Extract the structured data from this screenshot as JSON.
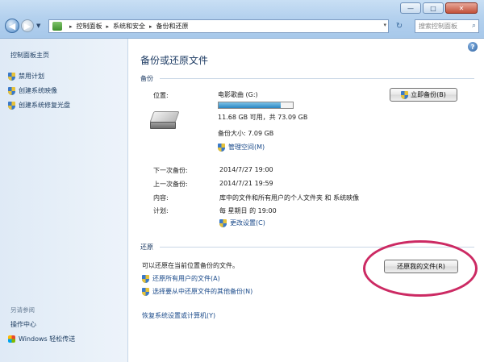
{
  "window": {
    "minimize_glyph": "—",
    "maximize_glyph": "□",
    "close_glyph": "✕"
  },
  "nav": {
    "back_glyph": "◀",
    "forward_glyph": "▶",
    "dropdown_glyph": "▼"
  },
  "address": {
    "crumbs": [
      "控制面板",
      "系统和安全",
      "备份和还原"
    ],
    "separator": "▸",
    "dropdown_glyph": "▾",
    "refresh_glyph": "↻"
  },
  "search": {
    "placeholder": "搜索控制面板",
    "icon_glyph": "⌕"
  },
  "sidebar": {
    "home": "控制面板主页",
    "items": [
      "禁用计划",
      "创建系统映像",
      "创建系统修复光盘"
    ],
    "see_also": "另请参阅",
    "links": [
      "操作中心",
      "Windows 轻松传送"
    ]
  },
  "help_glyph": "?",
  "main": {
    "title": "备份或还原文件",
    "backup": {
      "section": "备份",
      "location_label": "位置:",
      "drive_name": "电影歌曲 (G:)",
      "usage_fraction": 0.84,
      "space_text": "11.68 GB 可用，共 73.09 GB",
      "backup_size": "备份大小: 7.09 GB",
      "manage_space_link": "管理空间(M)",
      "backup_now_button": "立即备份(B)",
      "next_backup_label": "下一次备份:",
      "next_backup_value": "2014/7/27 19:00",
      "last_backup_label": "上一次备份:",
      "last_backup_value": "2014/7/21 19:59",
      "contents_label": "内容:",
      "contents_value": "库中的文件和所有用户的个人文件夹 和 系统映像",
      "schedule_label": "计划:",
      "schedule_value": "每 星期日 的 19:00",
      "change_settings_link": "更改设置(C)"
    },
    "restore": {
      "section": "还原",
      "description": "可以还原在当前位置备份的文件。",
      "restore_all_users_link": "还原所有用户的文件(A)",
      "select_other_backup_link": "选择要从中还原文件的其他备份(N)",
      "restore_my_files_button": "还原我的文件(R)",
      "recover_system_link": "恢复系统设置或计算机(Y)"
    }
  },
  "colors": {
    "annotation_circle": "#cc2a63",
    "progress_fill": "#2a86c2",
    "link": "#1a4a8a"
  }
}
